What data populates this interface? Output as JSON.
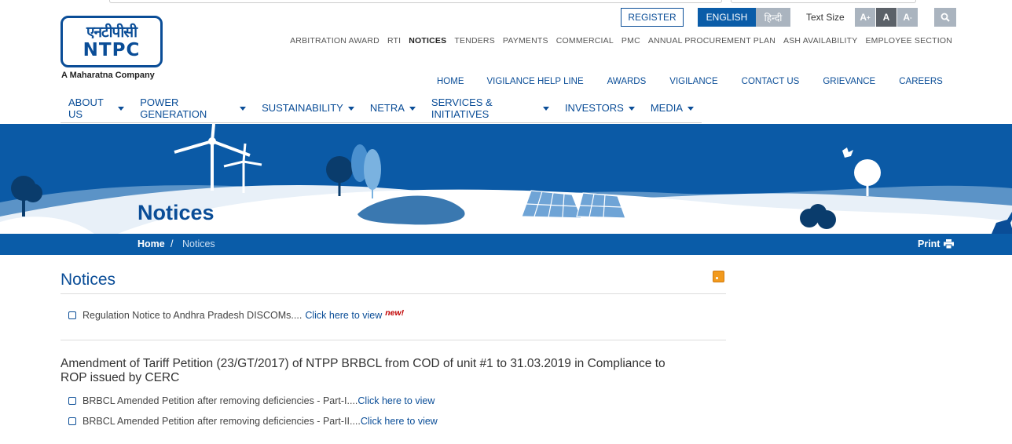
{
  "logo": {
    "hindi": "एनटीपीसी",
    "english": "NTPC",
    "tagline": "A Maharatna Company"
  },
  "header": {
    "register": "REGISTER",
    "lang_english": "ENGLISH",
    "lang_hindi": "हिन्दी",
    "text_size_label": "Text Size",
    "ts_plus": "A",
    "ts_plus_sup": "+",
    "ts_normal": "A",
    "ts_minus": "A",
    "ts_minus_sup": "-"
  },
  "util_nav": [
    "ARBITRATION AWARD",
    "RTI",
    "NOTICES",
    "TENDERS",
    "PAYMENTS",
    "COMMERCIAL",
    "PMC",
    "ANNUAL PROCUREMENT PLAN",
    "ASH AVAILABILITY",
    "EMPLOYEE SECTION"
  ],
  "sec_nav": [
    "HOME",
    "VIGILANCE HELP LINE",
    "AWARDS",
    "VIGILANCE",
    "CONTACT US",
    "GRIEVANCE",
    "CAREERS"
  ],
  "main_nav": [
    "ABOUT US",
    "POWER GENERATION",
    "SUSTAINABILITY",
    "NETRA",
    "SERVICES & INITIATIVES",
    "INVESTORS",
    "MEDIA"
  ],
  "banner": {
    "title": "Notices"
  },
  "breadcrumb": {
    "home": "Home",
    "sep": "/",
    "current": "Notices",
    "print": "Print"
  },
  "content": {
    "title": "Notices",
    "notice1": {
      "text": "Regulation Notice to Andhra Pradesh DISCOMs....",
      "link": "Click here to view",
      "badge": "new!"
    },
    "section_heading": "Amendment of Tariff Petition (23/GT/2017) of NTPP BRBCL from COD of unit #1 to 31.03.2019 in Compliance to ROP issued by CERC",
    "item1": {
      "text": "BRBCL Amended Petition after removing deficiencies - Part-I....",
      "link": "Click here to view"
    },
    "item2": {
      "text": "BRBCL Amended Petition after removing deficiencies - Part-II....",
      "link": "Click here to view"
    }
  },
  "colors": {
    "brand_blue": "#0a4d97",
    "bar_blue": "#0a5ca8",
    "new_red": "#c00000"
  }
}
